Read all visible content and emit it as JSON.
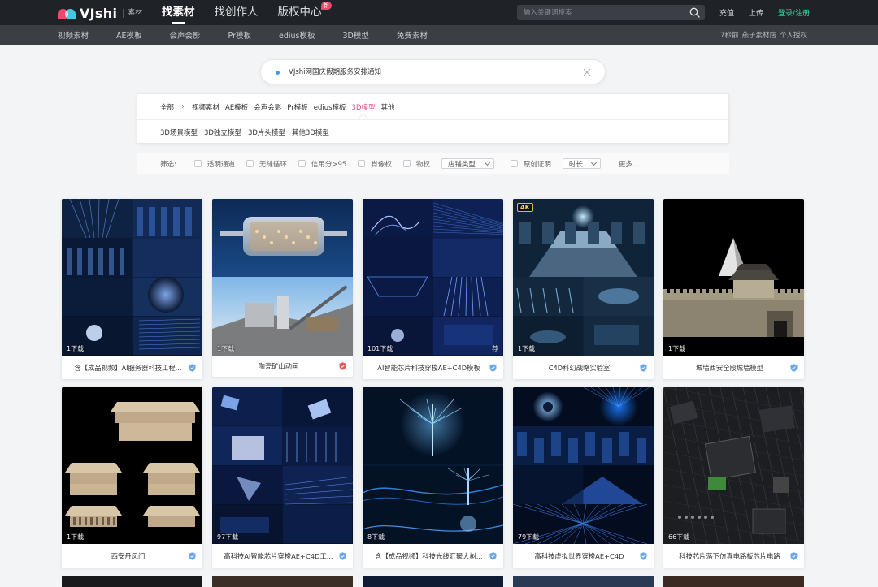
{
  "brand": {
    "name": "VJshi",
    "tag": "素材"
  },
  "main_nav": [
    {
      "label": "找素材",
      "active": true
    },
    {
      "label": "找创作人",
      "active": false
    },
    {
      "label": "版权中心",
      "active": false,
      "badge": "新"
    }
  ],
  "search": {
    "placeholder": "输入关键词搜索",
    "icon": "search-icon"
  },
  "top_links": {
    "recharge": "充值",
    "upload": "上传",
    "login": "登录/注册"
  },
  "sub_nav": [
    "视频素材",
    "AE模板",
    "会声会影",
    "Pr模板",
    "edius模板",
    "3D模型",
    "免费素材"
  ],
  "sub_status": {
    "time": "7秒前",
    "store": "燕子素材店",
    "license": "个人授权"
  },
  "notice": {
    "text": "VJshi网国庆假期服务安排通知"
  },
  "categories": {
    "all": "全部",
    "level1": [
      "视频素材",
      "AE模板",
      "会声会影",
      "Pr模板",
      "edius模板",
      "3D模型",
      "其他"
    ],
    "current": "3D模型",
    "level2": [
      "3D场景模型",
      "3D独立模型",
      "3D片头模型",
      "其他3D模型"
    ]
  },
  "filters": {
    "label": "筛选:",
    "checks": [
      "透明通道",
      "无缝循环",
      "信用分>95",
      "肖像权",
      "物权"
    ],
    "select_store": "店铺类型",
    "check_original": "原创证明",
    "select_duration": "时长",
    "more": "更多..."
  },
  "cards": [
    {
      "title": "含【成品视频】AI服务器科技工程...",
      "downloads": "1下载",
      "shield": "blue",
      "theme": "server"
    },
    {
      "title": "陶瓷矿山动画",
      "downloads": "1下载",
      "shield": "red",
      "theme": "kiln"
    },
    {
      "title": "AI智能芯片科技穿梭AE+C4D模板",
      "downloads": "101下载",
      "rec": "荐",
      "shield": "blue",
      "theme": "ai"
    },
    {
      "title": "C4D科幻战略实验室",
      "downloads": "1下载",
      "badge": "4K",
      "shield": "blue",
      "theme": "lab"
    },
    {
      "title": "城墙西安全段城墙模型",
      "downloads": "1下载",
      "shield": "blue",
      "theme": "wall"
    },
    {
      "title": "西安丹凤门",
      "downloads": "1下载",
      "shield": "blue",
      "theme": "palace"
    },
    {
      "title": "高科技AI智能芯片穿梭AE+C4D工...",
      "downloads": "97下载",
      "shield": "blue",
      "theme": "chip"
    },
    {
      "title": "含【成品视频】科技光线汇聚大树...",
      "downloads": "8下载",
      "shield": "blue",
      "theme": "tree"
    },
    {
      "title": "高科技虚拟世界穿梭AE+C4D",
      "downloads": "79下载",
      "shield": "blue",
      "theme": "virtual"
    },
    {
      "title": "科技芯片落下仿真电路板芯片电路",
      "downloads": "66下载",
      "shield": "blue",
      "theme": "board"
    }
  ]
}
